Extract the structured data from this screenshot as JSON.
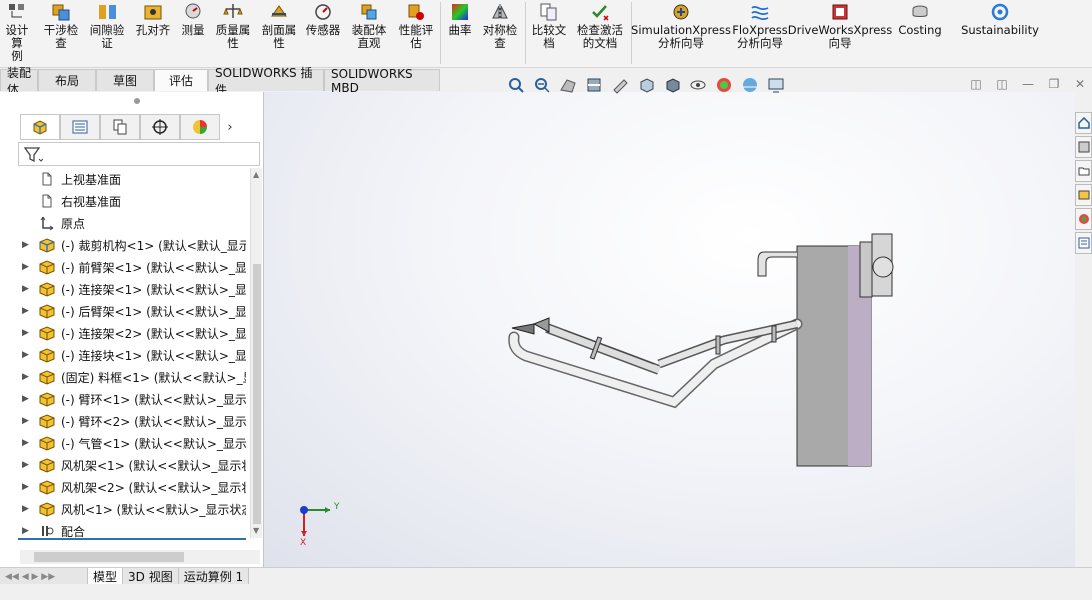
{
  "ribbon": {
    "buttons": [
      {
        "label": "设计算\n例",
        "icon": "design-study-icon"
      },
      {
        "label": "干涉检\n查",
        "icon": "interference-icon"
      },
      {
        "label": "间隙验\n证",
        "icon": "clearance-icon"
      },
      {
        "label": "孔对齐",
        "icon": "hole-alignment-icon"
      },
      {
        "label": "测量",
        "icon": "measure-icon"
      },
      {
        "label": "质量属\n性",
        "icon": "mass-properties-icon"
      },
      {
        "label": "剖面属\n性",
        "icon": "section-properties-icon"
      },
      {
        "label": "传感器",
        "icon": "sensor-icon"
      },
      {
        "label": "装配体\n直观",
        "icon": "assembly-visualization-icon"
      },
      {
        "label": "性能评\n估",
        "icon": "performance-evaluation-icon"
      },
      {
        "label": "曲率",
        "icon": "curvature-icon"
      },
      {
        "label": "对称检\n查",
        "icon": "symmetry-check-icon"
      },
      {
        "label": "比较文\n档",
        "icon": "compare-documents-icon"
      },
      {
        "label": "检查激活\n的文档",
        "icon": "check-active-document-icon"
      },
      {
        "label": "SimulationXpress\n分析向导",
        "icon": "simulationxpress-icon"
      },
      {
        "label": "FloXpress\n分析向导",
        "icon": "floxpress-icon"
      },
      {
        "label": "DriveWorksXpress\n向导",
        "icon": "driveworksxpress-icon"
      },
      {
        "label": "Costing",
        "icon": "costing-icon"
      },
      {
        "label": "Sustainability",
        "icon": "sustainability-icon"
      }
    ]
  },
  "cmd_tabs": [
    {
      "label": "装配体"
    },
    {
      "label": "布局"
    },
    {
      "label": "草图"
    },
    {
      "label": "评估"
    },
    {
      "label": "SOLIDWORKS 插件"
    },
    {
      "label": "SOLIDWORKS MBD"
    }
  ],
  "tree": {
    "items": [
      {
        "label": "上视基准面",
        "icon": "plane-icon",
        "expandable": false
      },
      {
        "label": "右视基准面",
        "icon": "plane-icon",
        "expandable": false
      },
      {
        "label": "原点",
        "icon": "origin-icon",
        "expandable": false
      },
      {
        "label": "(-) 裁剪机构<1> (默认<默认_显示",
        "icon": "subassembly-icon",
        "expandable": true
      },
      {
        "label": "(-) 前臂架<1> (默认<<默认>_显示",
        "icon": "part-icon",
        "expandable": true
      },
      {
        "label": "(-) 连接架<1> (默认<<默认>_显示",
        "icon": "part-icon",
        "expandable": true
      },
      {
        "label": "(-) 后臂架<1> (默认<<默认>_显示",
        "icon": "part-icon",
        "expandable": true
      },
      {
        "label": "(-) 连接架<2> (默认<<默认>_显示",
        "icon": "part-icon",
        "expandable": true
      },
      {
        "label": "(-) 连接块<1> (默认<<默认>_显示",
        "icon": "part-icon",
        "expandable": true
      },
      {
        "label": "(固定) 料框<1> (默认<<默认>_显",
        "icon": "part-icon",
        "expandable": true
      },
      {
        "label": "(-) 臂环<1> (默认<<默认>_显示状",
        "icon": "part-icon",
        "expandable": true
      },
      {
        "label": "(-) 臂环<2> (默认<<默认>_显示状",
        "icon": "part-icon",
        "expandable": true
      },
      {
        "label": "(-) 气管<1> (默认<<默认>_显示状",
        "icon": "part-icon",
        "expandable": true
      },
      {
        "label": "风机架<1> (默认<<默认>_显示状",
        "icon": "part-icon",
        "expandable": true
      },
      {
        "label": "风机架<2> (默认<<默认>_显示状",
        "icon": "part-icon",
        "expandable": true
      },
      {
        "label": "风机<1> (默认<<默认>_显示状态",
        "icon": "part-icon",
        "expandable": true
      },
      {
        "label": "配合",
        "icon": "mates-icon",
        "expandable": true
      }
    ]
  },
  "bottom_tabs": [
    {
      "label": "模型"
    },
    {
      "label": "3D 视图"
    },
    {
      "label": "运动算例 1"
    }
  ],
  "triad": {
    "y_label": "Y",
    "x_label": "X"
  },
  "colors": {
    "part_yellow": "#f1c232",
    "accent_blue": "#2f6fb3",
    "viewport_edge": "#dfe2ec"
  }
}
